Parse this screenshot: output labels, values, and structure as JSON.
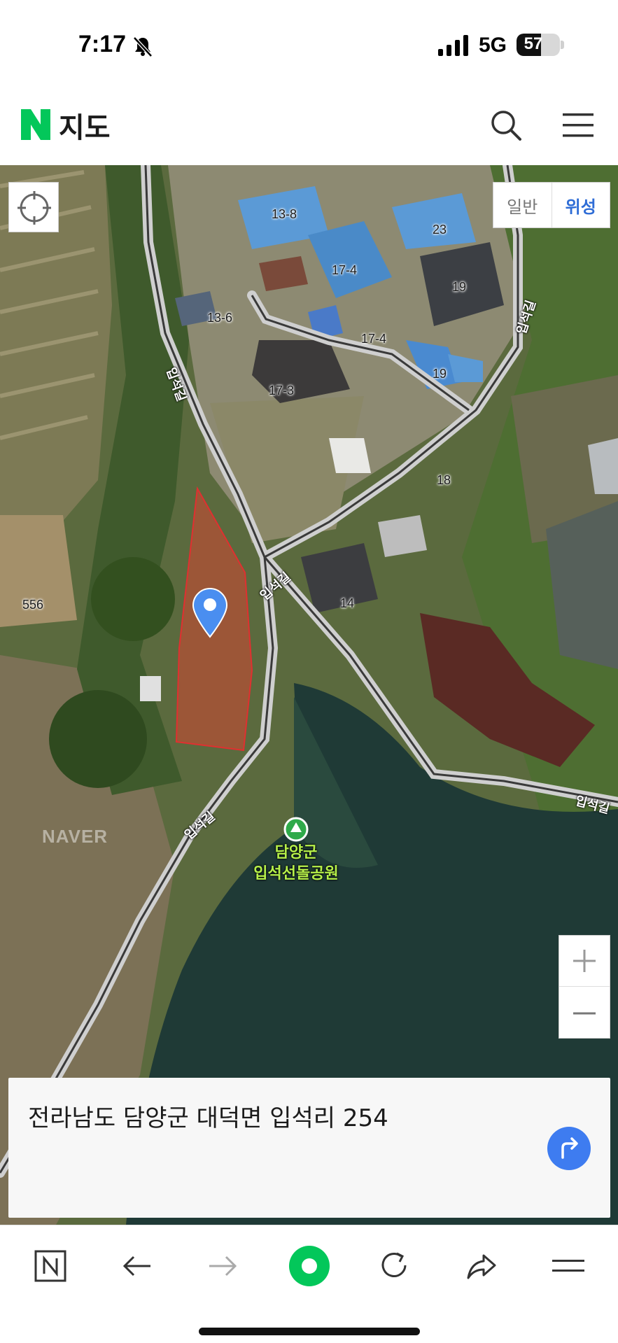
{
  "status_bar": {
    "time": "7:17",
    "network": "5G",
    "battery": "57",
    "battery_level": 0.57
  },
  "header": {
    "title": "지도",
    "logo_letter": "N"
  },
  "map": {
    "type_options": [
      "일반",
      "위성"
    ],
    "selected_type": "위성",
    "building_numbers": [
      "13-8",
      "23",
      "17-4",
      "19",
      "13-6",
      "17-4",
      "19",
      "17-3",
      "18",
      "556",
      "14"
    ],
    "road_labels": [
      "입석길",
      "입석길",
      "입석길",
      "입석길",
      "입석길"
    ],
    "poi": {
      "name_line1": "담양군",
      "name_line2": "입석선돌공원"
    },
    "watermark": "NAVER",
    "zoom_in_label": "+",
    "zoom_out_label": "−"
  },
  "address_card": {
    "address": "전라남도 담양군 대덕면 입석리 254"
  },
  "colors": {
    "brand_green": "#03c75a",
    "accent_blue": "#3e7cf0",
    "parcel_red": "#e03030"
  },
  "icons": [
    "bell-muted-icon",
    "signal-icon",
    "search-icon",
    "menu-icon",
    "locate-icon",
    "map-pin-icon",
    "route-icon",
    "naver-home-icon",
    "back-arrow-icon",
    "forward-arrow-icon",
    "green-dot-icon",
    "reload-icon",
    "share-icon",
    "hamburger-icon"
  ]
}
